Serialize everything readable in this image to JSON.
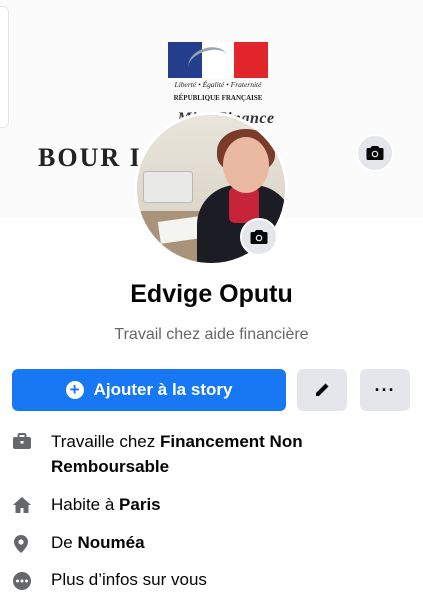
{
  "cover": {
    "motto_line1": "Liberté • Égalité • Fraternité",
    "motto_line2": "RÉPUBLIQUE FRANÇAISE",
    "ministry_text": "Mini    Finance",
    "bourse_text": "BOUR            IALE"
  },
  "profile": {
    "name": "Edvige Oputu",
    "bio": "Travail chez aide financière"
  },
  "actions": {
    "story_label": "Ajouter à la story",
    "more_label": "···"
  },
  "details": [
    {
      "icon": "briefcase-icon",
      "prefix": "Travaille chez ",
      "bold": "Financement Non Remboursable",
      "suffix": ""
    },
    {
      "icon": "home-icon",
      "prefix": "Habite à ",
      "bold": "Paris",
      "suffix": ""
    },
    {
      "icon": "location-pin-icon",
      "prefix": "De ",
      "bold": "Nouméa",
      "suffix": ""
    },
    {
      "icon": "more-circle-icon",
      "prefix": "Plus d’infos sur vous",
      "bold": "",
      "suffix": ""
    }
  ],
  "colors": {
    "accent": "#1877f2",
    "secondary_text": "#65676b",
    "button_gray": "#e4e6eb"
  }
}
